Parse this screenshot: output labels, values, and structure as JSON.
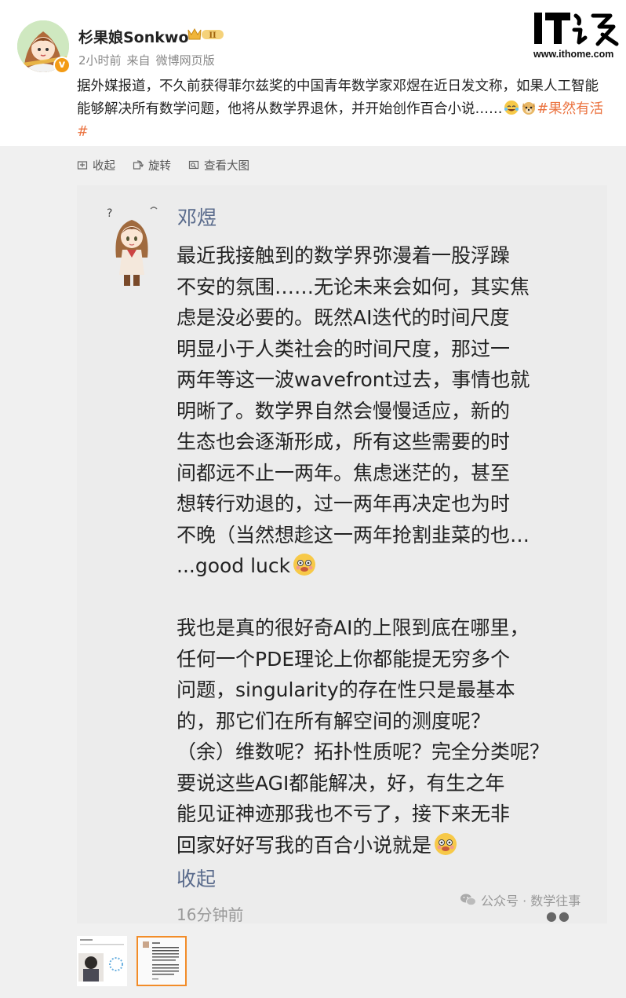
{
  "post": {
    "user_name": "杉果娘Sonkwo",
    "verified_mark": "v",
    "vip_level": "II",
    "time": "2小时前",
    "source_prefix": "来自",
    "source": "微博网页版",
    "text": "据外媒报道，不久前获得菲尔兹奖的中国青年数学家邓煜在近日发文称，如果人工智能能够解决所有数学问题，他将从数学界退休，并开始创作百合小说……",
    "hashtag": "#果然有活#",
    "emojis": [
      "laughing-tears-emoji",
      "doge-emoji"
    ]
  },
  "logo": {
    "brand": "IT之家",
    "url": "www.ithome.com"
  },
  "actions": [
    {
      "label": "收起",
      "icon": "collapse-icon"
    },
    {
      "label": "旋转",
      "icon": "rotate-icon"
    },
    {
      "label": "查看大图",
      "icon": "view-large-icon"
    }
  ],
  "screenshot": {
    "author": "邓煜",
    "paragraphs": [
      [
        "最近我接触到的数学界弥漫着一股浮躁",
        "不安的氛围……无论未来会如何，其实焦",
        "虑是没必要的。既然AI迭代的时间尺度",
        "明显小于人类社会的时间尺度，那过一",
        "两年等这一波wavefront过去，事情也就",
        "明晰了。数学界自然会慢慢适应，新的",
        "生态也会逐渐形成，所有这些需要的时",
        "间都远不止一两年。焦虑迷茫的，甚至",
        "想转行劝退的，过一两年再决定也为时",
        "不晚（当然想趁这一两年抢割韭菜的也…",
        "...good luck"
      ],
      [
        "我也是真的很好奇AI的上限到底在哪里，",
        "任何一个PDE理论上你都能提无穷多个",
        "问题，singularity的存在性只是最基本",
        "的，那它们在所有解空间的测度呢？",
        "（余）维数呢？拓扑性质呢？完全分类呢？",
        "要说这些AGI都能解决，好，有生之年",
        "能见证神迹那我也不亏了，接下来无非",
        "回家好好写我的百合小说就是"
      ]
    ],
    "collapse_label": "收起",
    "time": "16分钟前",
    "watermark": "公众号 · 数学往事",
    "colors": {
      "link": "#5a6b8c",
      "hashtag": "#eb7340",
      "active_thumb": "#f28c28"
    }
  }
}
